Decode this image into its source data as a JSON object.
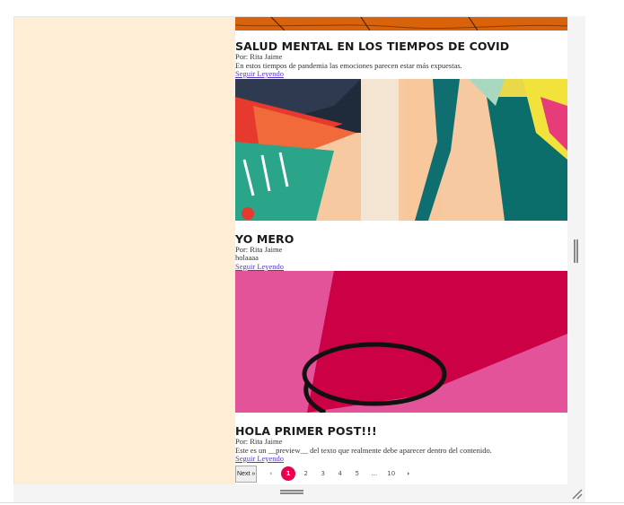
{
  "posts": [
    {
      "title": "SALUD MENTAL EN LOS TIEMPOS DE COVID",
      "author": "Por: Rita Jaime",
      "excerpt": "En estos tiempos de pandemia las emociones parecen estar más expuestas.",
      "more": "Seguir Leyendo"
    },
    {
      "title": "YO MERO",
      "author": "Por: Rita Jaime",
      "excerpt": "holaaaa",
      "more": "Seguir Leyendo"
    },
    {
      "title": "HOLA PRIMER POST!!!",
      "author": "Por: Rita Jaime",
      "excerpt": "Este es un __preview__ del texto que realmente debe aparecer dentro del contenido.",
      "more": "Seguir Leyendo"
    }
  ],
  "pagination": {
    "next": "Next »",
    "prev_icon": "chevron-left-icon",
    "next_icon": "chevron-right-icon",
    "pages": [
      "1",
      "2",
      "3",
      "4",
      "5",
      "...",
      "10"
    ],
    "active": "1"
  },
  "colors": {
    "sidebar": "#ffeed5",
    "active_page": "#e8004f",
    "link": "#5b37c9"
  }
}
